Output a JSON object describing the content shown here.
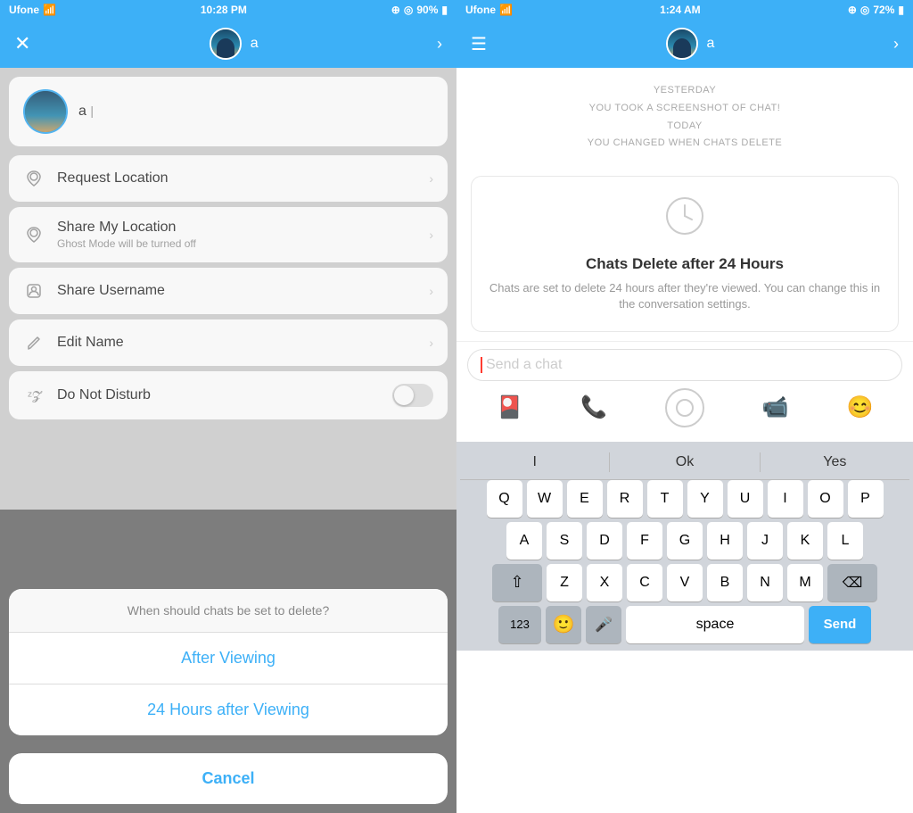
{
  "left": {
    "statusBar": {
      "carrier": "Ufone",
      "time": "10:28 PM",
      "battery": "90%"
    },
    "header": {
      "name": "a"
    },
    "friendCard": {
      "name": "a",
      "cursor": "|"
    },
    "menuItems": [
      {
        "id": "request-location",
        "icon": "📍",
        "title": "Request Location",
        "subtitle": "",
        "hasChevron": true,
        "hasToggle": false
      },
      {
        "id": "share-location",
        "icon": "📍",
        "title": "Share My Location",
        "subtitle": "Ghost Mode will be turned off",
        "hasChevron": true,
        "hasToggle": false
      },
      {
        "id": "share-username",
        "icon": "👻",
        "title": "Share Username",
        "subtitle": "",
        "hasChevron": true,
        "hasToggle": false
      },
      {
        "id": "edit-name",
        "icon": "✏️",
        "title": "Edit Name",
        "subtitle": "",
        "hasChevron": true,
        "hasToggle": false
      },
      {
        "id": "do-not-disturb",
        "icon": "💤",
        "title": "Do Not Disturb",
        "subtitle": "",
        "hasChevron": false,
        "hasToggle": true
      }
    ],
    "actionSheet": {
      "title": "When should chats be set to delete?",
      "options": [
        "After Viewing",
        "24 Hours after Viewing"
      ],
      "cancelLabel": "Cancel"
    }
  },
  "right": {
    "statusBar": {
      "carrier": "Ufone",
      "time": "1:24 AM",
      "battery": "72%"
    },
    "header": {
      "name": "a"
    },
    "systemMessages": [
      "YESTERDAY",
      "YOU TOOK A SCREENSHOT OF CHAT!",
      "TODAY",
      "YOU CHANGED WHEN CHATS DELETE"
    ],
    "notification": {
      "title": "Chats Delete after 24 Hours",
      "description": "Chats are set to delete 24 hours after they're viewed. You can change this in the conversation settings."
    },
    "input": {
      "placeholder": "Send a chat"
    },
    "keyboard": {
      "suggestions": [
        "I",
        "Ok",
        "Yes"
      ],
      "rows": [
        [
          "Q",
          "W",
          "E",
          "R",
          "T",
          "Y",
          "U",
          "I",
          "O",
          "P"
        ],
        [
          "A",
          "S",
          "D",
          "F",
          "G",
          "H",
          "J",
          "K",
          "L"
        ],
        [
          "Z",
          "X",
          "C",
          "V",
          "B",
          "N",
          "M"
        ]
      ],
      "sendLabel": "Send",
      "spaceLabel": "space",
      "numLabel": "123"
    }
  }
}
